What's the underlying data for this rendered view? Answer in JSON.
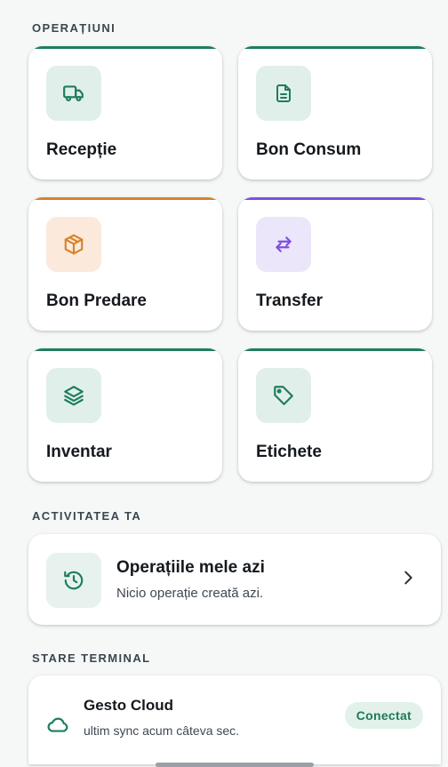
{
  "operations_title": "OPERAȚIUNI",
  "operations": [
    {
      "label": "Recepție",
      "icon": "truck-icon",
      "accent": "#1e7d5c",
      "icon_bg": "#e1efea",
      "icon_color": "#1e7d5c"
    },
    {
      "label": "Bon Consum",
      "icon": "document-icon",
      "accent": "#1e7d5c",
      "icon_bg": "#e1efea",
      "icon_color": "#1e7d5c"
    },
    {
      "label": "Bon Predare",
      "icon": "package-icon",
      "accent": "#d9822b",
      "icon_bg": "#fbe9dc",
      "icon_color": "#d9822b"
    },
    {
      "label": "Transfer",
      "icon": "arrows-exchange-icon",
      "accent": "#7b4fe0",
      "icon_bg": "#ece6fb",
      "icon_color": "#7b4fe0"
    },
    {
      "label": "Inventar",
      "icon": "layers-icon",
      "accent": "#1e7d5c",
      "icon_bg": "#e1efea",
      "icon_color": "#1e7d5c"
    },
    {
      "label": "Etichete",
      "icon": "tag-icon",
      "accent": "#1e7d5c",
      "icon_bg": "#e1efea",
      "icon_color": "#1e7d5c"
    }
  ],
  "activity_title": "ACTIVITATEA TA",
  "activity": {
    "title": "Operațiile mele azi",
    "subtitle": "Nicio operație creată azi.",
    "icon": "history-icon"
  },
  "terminal_title": "STARE TERMINAL",
  "terminal": {
    "name": "Gesto Cloud",
    "sync": "ultim sync acum câteva sec.",
    "status": "Conectat",
    "icon": "cloud-icon"
  }
}
